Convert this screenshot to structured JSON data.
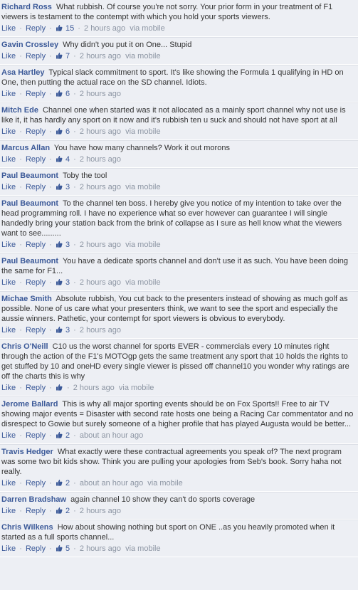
{
  "ui": {
    "like": "Like",
    "reply": "Reply",
    "dot": "·",
    "via": "via mobile"
  },
  "comments": [
    {
      "author": "Richard Ross",
      "text": "What rubbish. Of course you're not sorry. Your prior form in your treatment of F1 viewers is testament to the contempt with which you hold your sports viewers.",
      "likes": "15",
      "time": "2 hours ago",
      "via": "via mobile"
    },
    {
      "author": "Gavin Crossley",
      "text": "Why didn't you put it on One... Stupid",
      "likes": "7",
      "time": "2 hours ago",
      "via": "via mobile"
    },
    {
      "author": "Asa Hartley",
      "text": "Typical slack commitment to sport. It's like showing the Formula 1 qualifying in HD on One, then putting the actual race on the SD channel. Idiots.",
      "likes": "6",
      "time": "2 hours ago",
      "via": ""
    },
    {
      "author": "Mitch Ede",
      "text": "Channel one when started was it not allocated as a mainly sport channel why not use is like it, it has hardly any sport on it now and it's rubbish ten u suck and should not have sport at all",
      "likes": "6",
      "time": "2 hours ago",
      "via": "via mobile"
    },
    {
      "author": "Marcus Allan",
      "text": "You have how many channels? Work it out morons",
      "likes": "4",
      "time": "2 hours ago",
      "via": ""
    },
    {
      "author": "Paul Beaumont",
      "text": "Toby the tool",
      "likes": "3",
      "time": "2 hours ago",
      "via": "via mobile"
    },
    {
      "author": "Paul Beaumont",
      "text": "To the channel ten boss. I hereby give you notice of my intention to take over the head programming roll. I have no experience what so ever however can guarantee I will single handedly bring your station back from the brink of collapse as I sure as hell know what the viewers want to see.........",
      "likes": "3",
      "time": "2 hours ago",
      "via": "via mobile"
    },
    {
      "author": "Paul Beaumont",
      "text": "You have a dedicate sports channel and don't use it as such. You have been doing the same for F1...",
      "likes": "3",
      "time": "2 hours ago",
      "via": "via mobile"
    },
    {
      "author": "Michae Smith",
      "text": "Absolute rubbish, You cut back to the presenters instead of showing as much golf as possible. None of us care what your presenters think, we want to see the sport and especially the aussie winners. Pathetic, your contempt for sport viewers is obvious to everybody.",
      "likes": "3",
      "time": "2 hours ago",
      "via": ""
    },
    {
      "author": "Chris O'Neill",
      "text": "C10 us the worst channel for sports EVER - commercials every 10 minutes right through the action of the F1's MOTOgp gets the same treatment any sport that 10 holds the rights to get stuffed by 10 and oneHD every single viewer is pissed off channel10 you wonder why ratings are off the charts this is why",
      "likes": "",
      "time": "2 hours ago",
      "via": "via mobile"
    },
    {
      "author": "Jerome Ballard",
      "text": "This is why all major sporting events should be on Fox Sports!! Free to air TV showing major events = Disaster with second rate hosts one being a Racing Car commentator and no disrespect to Gowie but surely someone of a higher profile that has played Augusta would be better...",
      "likes": "2",
      "time": "about an hour ago",
      "via": ""
    },
    {
      "author": "Travis Hedger",
      "text": "What exactly were these contractual agreements you speak of? The next program was some two bit kids show. Think you are pulling your apologies from Seb's book. Sorry haha not really.",
      "likes": "2",
      "time": "about an hour ago",
      "via": "via mobile"
    },
    {
      "author": "Darren Bradshaw",
      "text": "again channel 10 show they can't do sports coverage",
      "likes": "2",
      "time": "2 hours ago",
      "via": ""
    },
    {
      "author": "Chris Wilkens",
      "text": "How about showing nothing but sport on ONE ..as you heavily promoted when it started as a full sports channel...",
      "likes": "5",
      "time": "2 hours ago",
      "via": "via mobile"
    }
  ]
}
